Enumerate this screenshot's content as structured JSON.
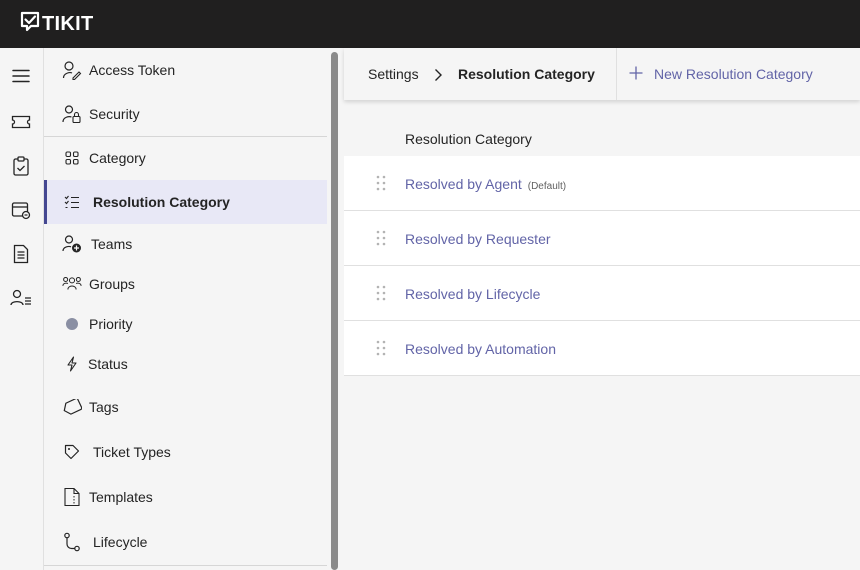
{
  "app": {
    "logo_text": "TIKIT"
  },
  "rail": {
    "items": [
      {
        "icon": "menu-icon"
      },
      {
        "icon": "ticket-icon"
      },
      {
        "icon": "clipboard-icon"
      },
      {
        "icon": "billing-icon"
      },
      {
        "icon": "document-icon"
      },
      {
        "icon": "people-list-icon"
      }
    ]
  },
  "sidebar": {
    "items": [
      {
        "label": "Access Token",
        "icon": "access-token-icon"
      },
      {
        "label": "Security",
        "icon": "security-icon"
      },
      {
        "label": "Category",
        "icon": "category-icon"
      },
      {
        "label": "Resolution Category",
        "icon": "list-check-icon"
      },
      {
        "label": "Teams",
        "icon": "teams-icon"
      },
      {
        "label": "Groups",
        "icon": "groups-icon"
      },
      {
        "label": "Priority",
        "icon": "priority-dot-icon"
      },
      {
        "label": "Status",
        "icon": "flash-icon"
      },
      {
        "label": "Tags",
        "icon": "tag-icon"
      },
      {
        "label": "Ticket Types",
        "icon": "diamond-icon"
      },
      {
        "label": "Templates",
        "icon": "template-icon"
      },
      {
        "label": "Lifecycle",
        "icon": "lifecycle-icon"
      }
    ]
  },
  "breadcrumb": {
    "parent": "Settings",
    "current": "Resolution Category"
  },
  "actions": {
    "new_label": "New Resolution Category"
  },
  "table": {
    "column_header": "Resolution Category",
    "rows": [
      {
        "name": "Resolved by Agent",
        "badge": "(Default)"
      },
      {
        "name": "Resolved by Requester",
        "badge": ""
      },
      {
        "name": "Resolved by Lifecycle",
        "badge": ""
      },
      {
        "name": "Resolved by Automation",
        "badge": ""
      }
    ]
  },
  "colors": {
    "accent": "#6264a7",
    "topbar": "#201f1f",
    "active_bg": "#e8e8f6"
  }
}
